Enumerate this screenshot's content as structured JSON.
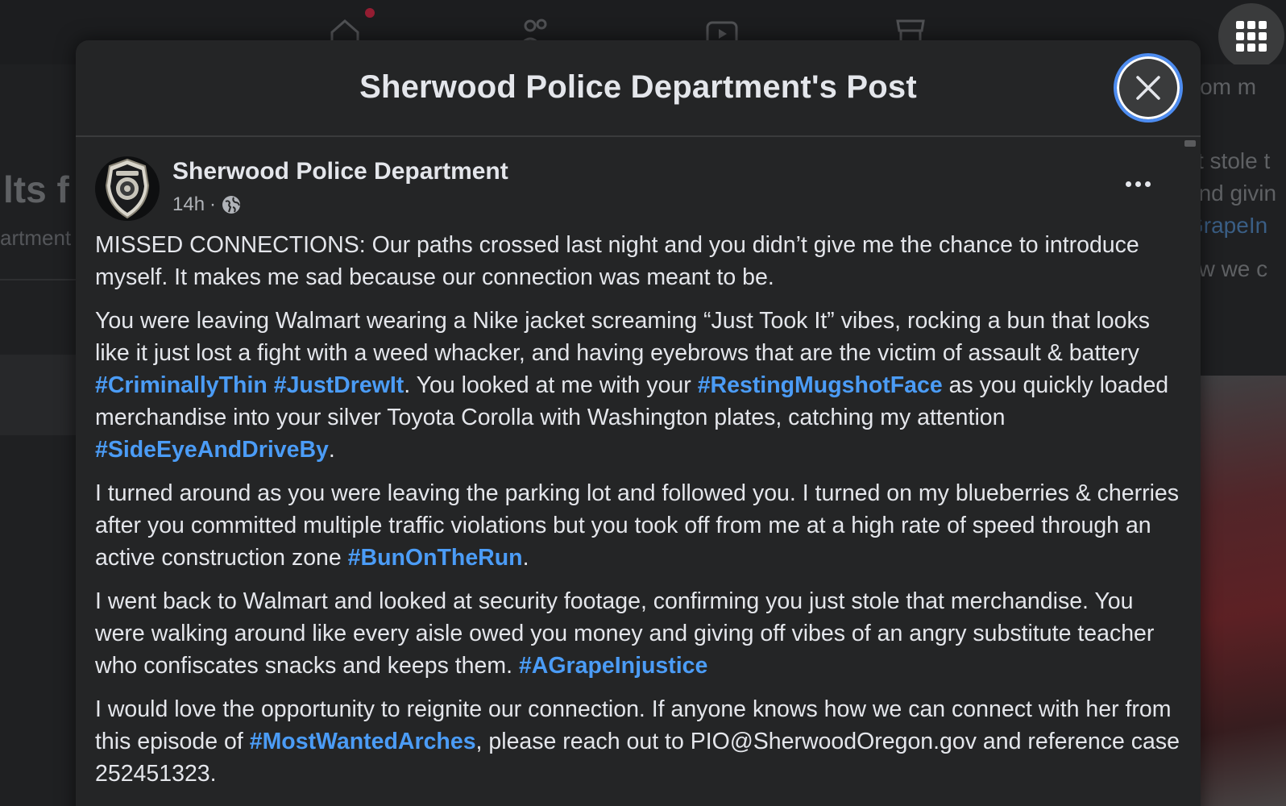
{
  "background": {
    "left_title": "lts f",
    "left_sub": "artment",
    "right_lines": [
      "from m",
      "st stole t",
      "and givin",
      "GrapeIn",
      "ow we c"
    ]
  },
  "modal": {
    "title": "Sherwood Police Department's Post",
    "close_label": "Close"
  },
  "post": {
    "author": "Sherwood Police Department",
    "time": "14h",
    "separator": "·",
    "paragraphs": [
      {
        "seg1": "MISSED CONNECTIONS: Our paths crossed last night and you didn’t give me the chance to introduce myself. It makes me sad because our connection was meant to be."
      },
      {
        "seg1": "You were leaving Walmart wearing a Nike jacket screaming “Just Took It” vibes, rocking a bun that looks like it just lost a fight with a weed whacker, and having eyebrows that are the victim of assault & battery ",
        "tag1": "#CriminallyThin",
        "sp1": " ",
        "tag2": "#JustDrewIt",
        "seg2": ". You looked at me with your ",
        "tag3": "#RestingMugshotFace",
        "seg3": " as you quickly loaded merchandise into your silver Toyota Corolla with Washington plates, catching my attention ",
        "tag4": "#SideEyeAndDriveBy",
        "seg4": "."
      },
      {
        "seg1": "I turned around as you were leaving the parking lot and followed you. I turned on my blueberries & cherries after you committed multiple traffic violations but you took off from me at a high rate of speed through an active construction zone ",
        "tag1": "#BunOnTheRun",
        "seg2": "."
      },
      {
        "seg1": "I went back to Walmart and looked at security footage, confirming you just stole that merchandise. You were walking around like every aisle owed you money and giving off vibes of an angry substitute teacher who confiscates snacks and keeps them. ",
        "tag1": "#AGrapeInjustice"
      },
      {
        "seg1": "I would love the opportunity to reignite our connection. If anyone knows how we can connect with her from this episode of ",
        "tag1": "#MostWantedArches",
        "seg2": ", please reach out to PIO@SherwoodOregon.gov and reference case 252451323."
      }
    ]
  },
  "icons": {
    "close": "close-icon",
    "globe": "globe-icon",
    "more": "more-options-icon",
    "apps": "apps-grid-icon"
  },
  "colors": {
    "background": "#18191a",
    "modal": "#242526",
    "text": "#e4e6eb",
    "secondary_text": "#b0b3b8",
    "hashtag": "#4b9cf6",
    "focus_ring": "#4d8cf0"
  }
}
